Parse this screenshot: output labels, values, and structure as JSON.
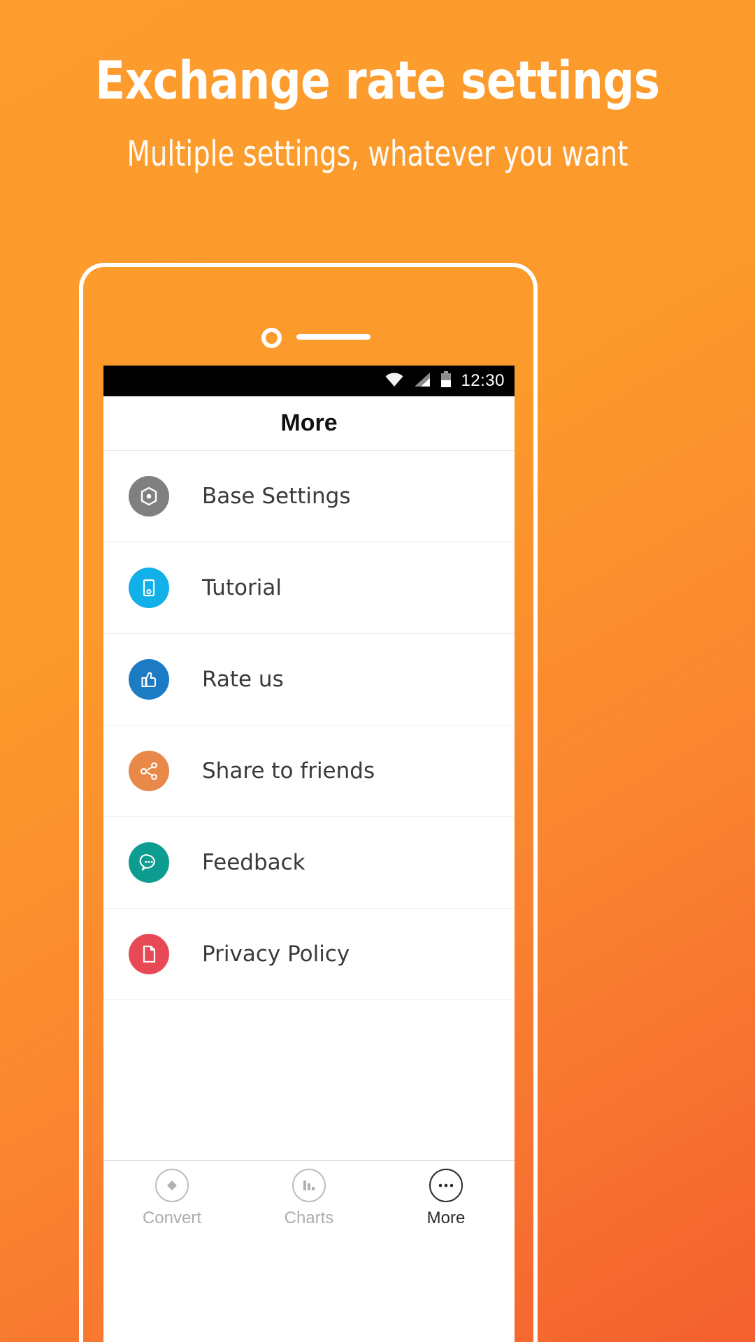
{
  "promo": {
    "title": "Exchange rate settings",
    "subtitle": "Multiple settings, whatever you want"
  },
  "theme": {
    "bg_top": "#FD9D2E",
    "bg_bottom": "#F4602F",
    "text_on_bg": "#FFFFFF"
  },
  "phone": {
    "frame_color": "#FFFFFF",
    "camera_icon": "camera-dot",
    "speaker_icon": "speaker-bar"
  },
  "statusbar": {
    "background": "#000000",
    "wifi_icon": "wifi-icon",
    "signal_icon": "cell-signal-icon",
    "battery_icon": "battery-icon",
    "time": "12:30"
  },
  "appbar": {
    "title": "More"
  },
  "menu": {
    "items": [
      {
        "label": "Base Settings",
        "icon": "gear-hex-icon",
        "color": "#808080"
      },
      {
        "label": "Tutorial",
        "icon": "device-icon",
        "color": "#12B0E8"
      },
      {
        "label": "Rate us",
        "icon": "thumbs-up-icon",
        "color": "#1D7BC4"
      },
      {
        "label": "Share to friends",
        "icon": "share-icon",
        "color": "#E8894A"
      },
      {
        "label": "Feedback",
        "icon": "chat-icon",
        "color": "#0D9C90"
      },
      {
        "label": "Privacy Policy",
        "icon": "document-icon",
        "color": "#E84A55"
      }
    ]
  },
  "tabbar": {
    "tabs": [
      {
        "label": "Convert",
        "icon": "diamond-icon",
        "active": false
      },
      {
        "label": "Charts",
        "icon": "bar-chart-icon",
        "active": false
      },
      {
        "label": "More",
        "icon": "ellipsis-icon",
        "active": true
      }
    ]
  }
}
